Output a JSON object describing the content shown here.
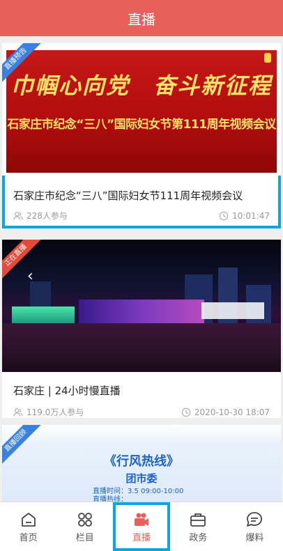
{
  "header": {
    "title": "直播"
  },
  "colors": {
    "brand": "#e8605a",
    "highlight": "#0aa6df",
    "ribbon_preview": "#3b80e0",
    "ribbon_live": "#e34a3a",
    "ribbon_replay": "#3b80e0"
  },
  "cards": [
    {
      "ribbon": "直播预告",
      "banner_line1": "巾帼心向党　奋斗新征程",
      "banner_line2": "石家庄市纪念“三八”国际妇女节第111周年视频会议",
      "title": "石家庄市纪念“三八”国际妇女节111周年视频会议",
      "participants": "228人参与",
      "time": "10:01:47"
    },
    {
      "ribbon": "正在直播",
      "title": "石家庄 | 24小时慢直播",
      "participants": "119.0万人参与",
      "time": "2020-10-30 18:07"
    },
    {
      "ribbon": "直播回顾",
      "banner_title": "《行风热线》",
      "banner_sub": "团市委",
      "banner_info1": "直播时间：3.5 09:00-10:00",
      "banner_info2": "直播热线："
    }
  ],
  "tabs": [
    {
      "label": "首页",
      "icon": "home-icon"
    },
    {
      "label": "栏目",
      "icon": "grid-icon"
    },
    {
      "label": "直播",
      "icon": "camera-icon"
    },
    {
      "label": "政务",
      "icon": "briefcase-icon"
    },
    {
      "label": "爆料",
      "icon": "chat-icon"
    }
  ]
}
